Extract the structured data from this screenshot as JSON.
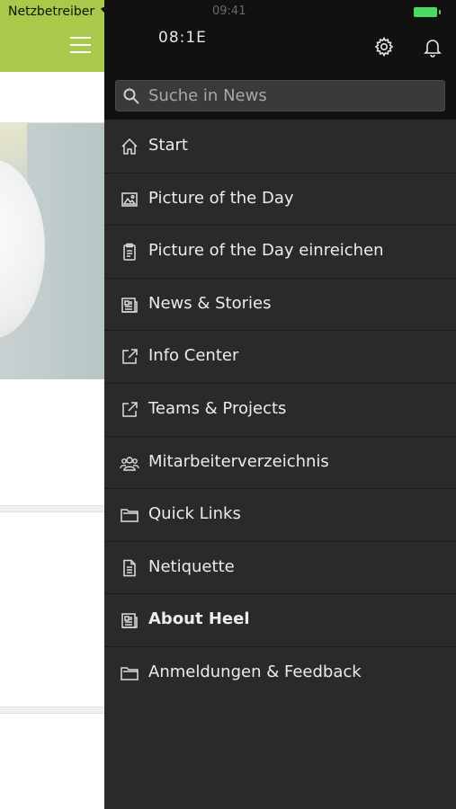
{
  "status_bar": {
    "carrier": "Netzbetreiber",
    "time": "09:41"
  },
  "drawer": {
    "header_time": "08:1E",
    "search": {
      "placeholder": "Suche in News",
      "value": ""
    },
    "items": [
      {
        "label": "Start",
        "icon": "home-icon",
        "bold": false
      },
      {
        "label": "Picture of the Day",
        "icon": "image-icon",
        "bold": false
      },
      {
        "label": "Picture of the Day einreichen",
        "icon": "clipboard-icon",
        "bold": false
      },
      {
        "label": "News & Stories",
        "icon": "newspaper-icon",
        "bold": false
      },
      {
        "label": "Info Center",
        "icon": "external-link-icon",
        "bold": false
      },
      {
        "label": "Teams & Projects",
        "icon": "external-link-icon",
        "bold": false
      },
      {
        "label": "Mitarbeiterverzeichnis",
        "icon": "people-icon",
        "bold": false
      },
      {
        "label": "Quick Links",
        "icon": "folder-icon",
        "bold": false
      },
      {
        "label": "Netiquette",
        "icon": "document-icon",
        "bold": false
      },
      {
        "label": "About Heel",
        "icon": "newspaper-icon",
        "bold": true
      },
      {
        "label": "Anmeldungen & Feedback",
        "icon": "folder-icon",
        "bold": false
      }
    ]
  },
  "colors": {
    "header_green": "#a9c94a",
    "drawer_bg": "#2a2a2a",
    "drawer_header_bg": "#111111",
    "battery": "#4cd964"
  }
}
